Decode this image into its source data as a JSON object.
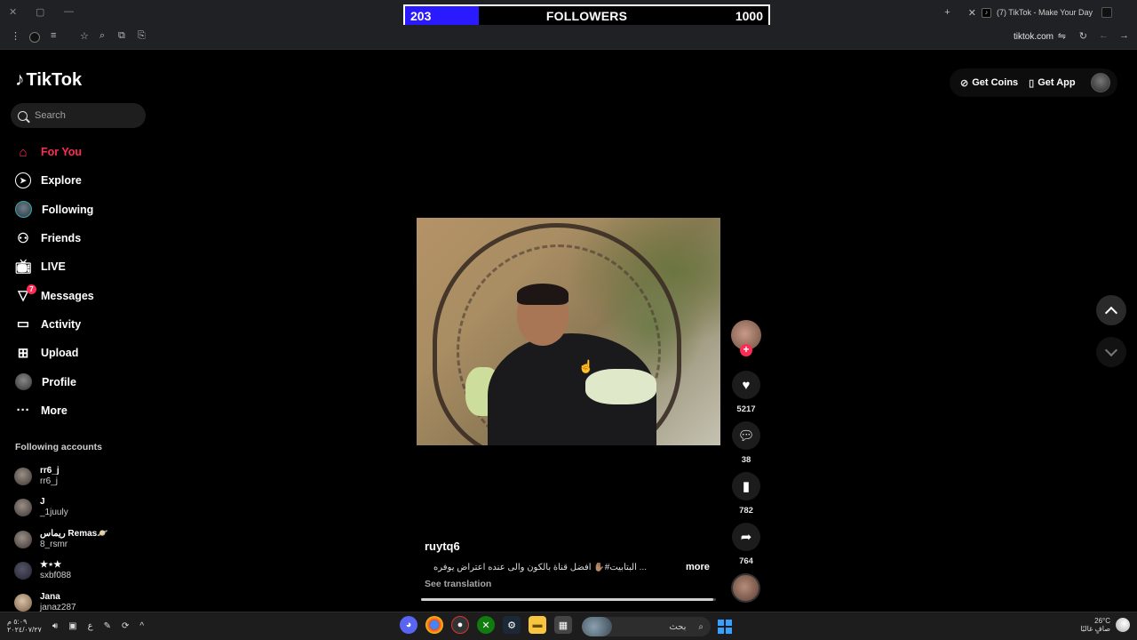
{
  "browser": {
    "tab_title": "(7) TikTok - Make Your Day",
    "url": "tiktok.com"
  },
  "overlay": {
    "followers_current": "203",
    "followers_label": "FOLLOWERS",
    "followers_goal": "1000",
    "followers_progress_fraction": 0.203,
    "fill_color": "#2a1aff"
  },
  "tiktok": {
    "logo_text": "TikTok",
    "search_placeholder": "Search",
    "nav": [
      {
        "label": "For You",
        "icon": "home-icon",
        "active": true
      },
      {
        "label": "Explore",
        "icon": "compass-icon"
      },
      {
        "label": "Following",
        "icon": "following-avatar-icon"
      },
      {
        "label": "Friends",
        "icon": "friends-icon"
      },
      {
        "label": "LIVE",
        "icon": "live-tv-icon"
      },
      {
        "label": "Messages",
        "icon": "messages-icon",
        "badge": "7"
      },
      {
        "label": "Activity",
        "icon": "activity-icon"
      },
      {
        "label": "Upload",
        "icon": "upload-icon"
      },
      {
        "label": "Profile",
        "icon": "profile-avatar-icon"
      },
      {
        "label": "More",
        "icon": "more-dots-icon"
      }
    ],
    "following_title": "Following accounts",
    "following_accounts": [
      {
        "name": "rr6_j",
        "handle": "rr6_j"
      },
      {
        "name": "J",
        "handle": "_1juuly"
      },
      {
        "name": "ريماس Remas🪐",
        "handle": "8_rsmr"
      },
      {
        "name": "★⋆★",
        "handle": "sxbf088"
      },
      {
        "name": "Jana",
        "handle": "janaz287"
      }
    ],
    "top_actions": {
      "get_coins": "Get Coins",
      "get_app": "Get App"
    },
    "video": {
      "username": "ruytq6",
      "caption": "... البتابيت#✋🏽 افضل قناة بالكون والى عنده اعتراض يوفره",
      "more_label": "more",
      "see_translation": "See translation",
      "progress_fraction": 0.99
    },
    "actions": {
      "likes": "5217",
      "comments": "38",
      "saves": "782",
      "shares": "764"
    },
    "accent_color": "#fe2c55"
  },
  "taskbar": {
    "search_placeholder": "بحث",
    "time": "٥:٠٩ م",
    "date": "٢٠٢٤/٠٧/٢٧",
    "language": "ع",
    "weather_temp": "26°C",
    "weather_desc": "صافٍ غالبًا"
  }
}
